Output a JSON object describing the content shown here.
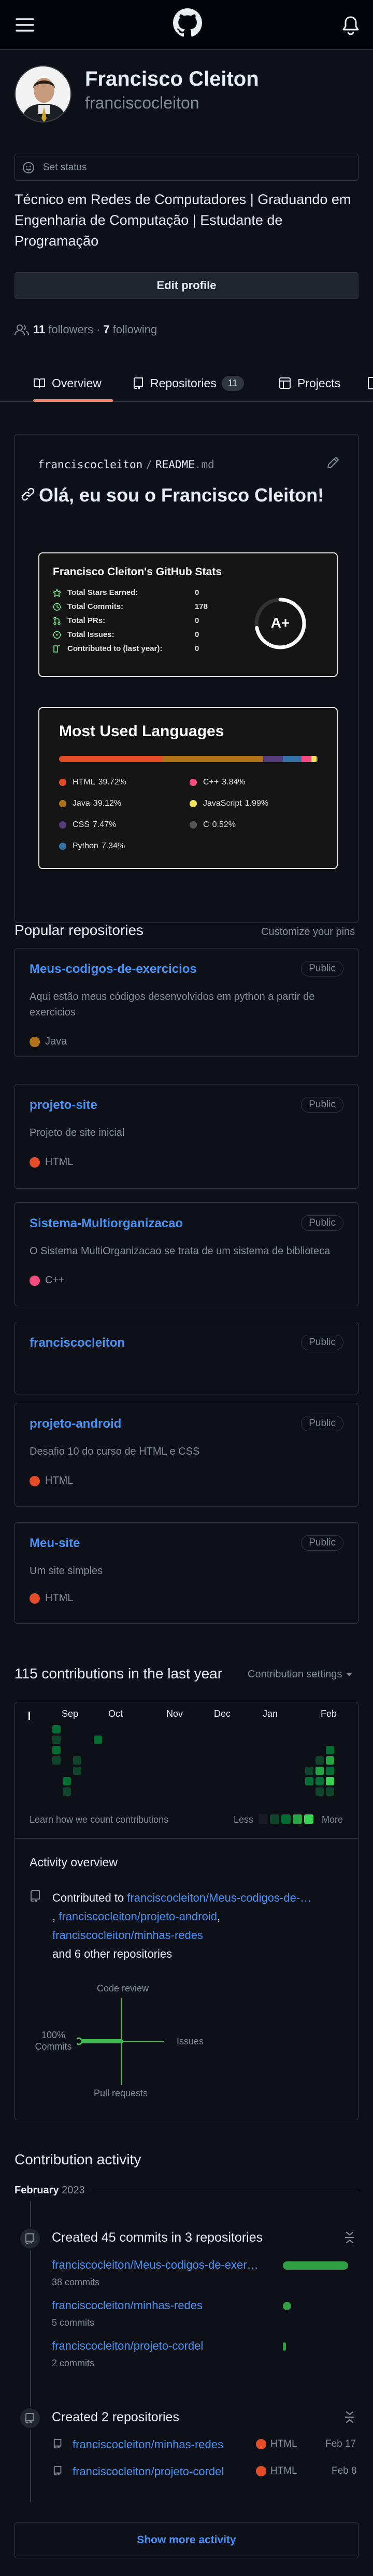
{
  "header": {
    "menu_icon": "hamburger-icon",
    "logo_icon": "github-mark-icon",
    "bell_icon": "bell-icon"
  },
  "profile": {
    "name": "Francisco Cleiton",
    "username": "franciscocleiton",
    "status": "Set status",
    "bio_lines": [
      "Técnico em Redes de Computadores | Graduando em",
      "Engenharia de Computação | Estudante de",
      "Programação"
    ],
    "edit_button": "Edit profile",
    "followers_count": "11",
    "followers_label": "followers",
    "dot": "·",
    "following_count": "7",
    "following_label": "following"
  },
  "tabs": {
    "overview": "Overview",
    "repositories": "Repositories",
    "repositories_count": "11",
    "projects": "Projects"
  },
  "readme": {
    "path_user": "franciscocleiton",
    "path_sep": "/",
    "path_file": "README",
    "path_ext": ".md",
    "heading": "Olá, eu sou o Francisco Cleiton!",
    "stats": {
      "title": "Francisco Cleiton's GitHub Stats",
      "rows": [
        {
          "label": "Total Stars Earned:",
          "value": "0"
        },
        {
          "label": "Total Commits:",
          "value": "178"
        },
        {
          "label": "Total PRs:",
          "value": "0"
        },
        {
          "label": "Total Issues:",
          "value": "0"
        },
        {
          "label": "Contributed to (last year):",
          "value": "0"
        }
      ],
      "grade": "A+",
      "grade_fraction": 0.72
    },
    "languages": {
      "title": "Most Used Languages",
      "items": [
        {
          "name": "HTML",
          "percent": "39.72%",
          "value": 39.72,
          "color": "#e34c26"
        },
        {
          "name": "C++",
          "percent": "3.84%",
          "value": 3.84,
          "color": "#f34b7d"
        },
        {
          "name": "Java",
          "percent": "39.12%",
          "value": 39.12,
          "color": "#b07219"
        },
        {
          "name": "JavaScript",
          "percent": "1.99%",
          "value": 1.99,
          "color": "#f1e05a"
        },
        {
          "name": "CSS",
          "percent": "7.47%",
          "value": 7.47,
          "color": "#563d7c"
        },
        {
          "name": "C",
          "percent": "0.52%",
          "value": 0.52,
          "color": "#555555"
        },
        {
          "name": "Python",
          "percent": "7.34%",
          "value": 7.34,
          "color": "#3572a5"
        }
      ]
    }
  },
  "popular": {
    "title": "Popular repositories",
    "customize": "Customize your pins",
    "repos": [
      {
        "name": "Meus-codigos-de-exercicios",
        "visibility": "Public",
        "desc": "Aqui estão meus códigos desenvolvidos em python a partir de exercicios",
        "lang": "Java",
        "lang_color": "#b07219"
      },
      {
        "name": "projeto-site",
        "visibility": "Public",
        "desc": "Projeto de site inicial",
        "lang": "HTML",
        "lang_color": "#e34c26"
      },
      {
        "name": "Sistema-Multiorganizacao",
        "visibility": "Public",
        "desc": "O Sistema MultiOrganizacao se trata de um sistema de biblioteca",
        "lang": "C++",
        "lang_color": "#f34b7d"
      },
      {
        "name": "franciscocleiton",
        "visibility": "Public",
        "desc": "",
        "lang": "",
        "lang_color": ""
      },
      {
        "name": "projeto-android",
        "visibility": "Public",
        "desc": "Desafio 10 do curso de HTML e CSS",
        "lang": "HTML",
        "lang_color": "#e34c26"
      },
      {
        "name": "Meu-site",
        "visibility": "Public",
        "desc": "Um site simples",
        "lang": "HTML",
        "lang_color": "#e34c26"
      }
    ]
  },
  "contributions": {
    "title": "115 contributions in the last year",
    "settings": "Contribution settings",
    "months": [
      "Sep",
      "Oct",
      "Nov",
      "Dec",
      "Jan",
      "Feb"
    ],
    "learn": "Learn how we count contributions",
    "less": "Less",
    "more": "More",
    "legend_colors": [
      "#161b22",
      "#0e4429",
      "#006d32",
      "#26a641",
      "#39d353"
    ]
  },
  "activity_overview": {
    "title": "Activity overview",
    "contributed_to": "Contributed to",
    "repo1": "franciscocleiton/Meus-codigos-de-…",
    "comma1": ",",
    "repo2": "franciscocleiton/projeto-android",
    "comma2": ",",
    "repo3": "franciscocleiton/minhas-redes",
    "others": "and 6 other repositories",
    "axis_top": "Code review",
    "axis_left_pct": "100%",
    "axis_left": "Commits",
    "axis_right": "Issues",
    "axis_bottom": "Pull requests"
  },
  "contribution_activity": {
    "title": "Contribution activity",
    "month": "February",
    "year": "2023",
    "commits": {
      "title": "Created 45 commits in 3 repositories",
      "repos": [
        {
          "name": "franciscocleiton/Meus-codigos-de-exer…",
          "count": "38 commits",
          "fraction": 1.0
        },
        {
          "name": "franciscocleiton/minhas-redes",
          "count": "5 commits",
          "fraction": 0.13
        },
        {
          "name": "franciscocleiton/projeto-cordel",
          "count": "2 commits",
          "fraction": 0.05
        }
      ]
    },
    "created": {
      "title": "Created 2 repositories",
      "repos": [
        {
          "name": "franciscocleiton/minhas-redes",
          "lang": "HTML",
          "date": "Feb 17"
        },
        {
          "name": "franciscocleiton/projeto-cordel",
          "lang": "HTML",
          "date": "Feb 8"
        }
      ]
    },
    "show_more": "Show more activity"
  }
}
